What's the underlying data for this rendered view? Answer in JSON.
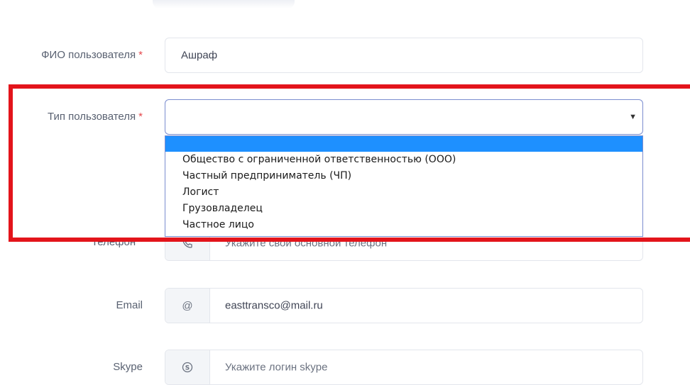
{
  "form": {
    "name_field": {
      "label": "ФИО пользователя",
      "required_mark": "*",
      "value": "Ашраф"
    },
    "user_type_field": {
      "label": "Тип пользователя",
      "required_mark": "*",
      "value": "",
      "arrow": "▼",
      "options": [
        "",
        "Общество с ограниченной ответственностью (ООО)",
        "Частный предприниматель (ЧП)",
        "Логист",
        "Грузовладелец",
        "Частное лицо"
      ]
    },
    "phone_field": {
      "label": "Телефон",
      "required_mark": "*",
      "icon": "phone-icon",
      "placeholder": "Укажите свой основной телефон"
    },
    "email_field": {
      "label": "Email",
      "icon": "at-icon",
      "icon_glyph": "@",
      "value": "easttransco@mail.ru"
    },
    "skype_field": {
      "label": "Skype",
      "icon": "skype-icon",
      "placeholder": "Укажите логин skype"
    }
  },
  "colors": {
    "highlight_box": "#e3141b",
    "selected_option": "#1e90ff",
    "required": "#e5484d",
    "select_border": "#7b8dcf"
  }
}
